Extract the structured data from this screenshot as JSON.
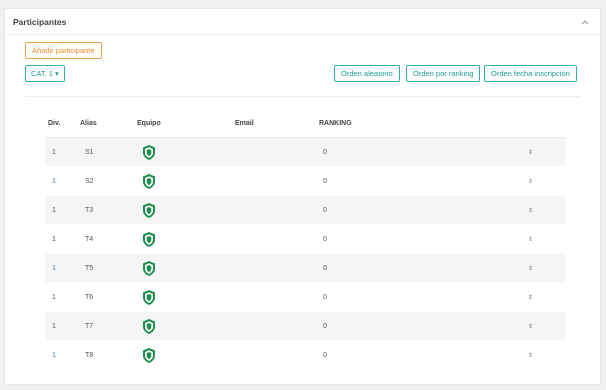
{
  "panel": {
    "title": "Participantes",
    "add_button_label": "Añadir participante",
    "category_button_label": "CAT. 1 ▾",
    "order_buttons": [
      "Orden aleatorio",
      "Orden por ranking",
      "Orden fecha inscripción"
    ]
  },
  "table": {
    "headers": {
      "div": "Div.",
      "alias": "Alias",
      "team": "Equipo",
      "email": "Email",
      "ranking": "RANKING"
    },
    "rows": [
      {
        "div": "1",
        "alias": "S1",
        "team_icon": "shield-icon",
        "email": "",
        "ranking": "0",
        "sort": "⇕"
      },
      {
        "div": "1",
        "alias": "S2",
        "team_icon": "shield-icon",
        "email": "",
        "ranking": "0",
        "sort": "⇕"
      },
      {
        "div": "1",
        "alias": "T3",
        "team_icon": "shield-icon",
        "email": "",
        "ranking": "0",
        "sort": "⇕"
      },
      {
        "div": "1",
        "alias": "T4",
        "team_icon": "shield-icon",
        "email": "",
        "ranking": "0",
        "sort": "⇕"
      },
      {
        "div": "1",
        "alias": "T5",
        "team_icon": "shield-icon",
        "email": "",
        "ranking": "0",
        "sort": "⇕"
      },
      {
        "div": "1",
        "alias": "T6",
        "team_icon": "shield-icon",
        "email": "",
        "ranking": "0",
        "sort": "⇕"
      },
      {
        "div": "1",
        "alias": "T7",
        "team_icon": "shield-icon",
        "email": "",
        "ranking": "0",
        "sort": "⇕"
      },
      {
        "div": "1",
        "alias": "T8",
        "team_icon": "shield-icon",
        "email": "",
        "ranking": "0",
        "sort": "⇕"
      }
    ]
  },
  "colors": {
    "accent_orange": "#ef8c2a",
    "accent_teal": "#1d9e8e",
    "shield_green": "#1e8f4e",
    "link_blue": "#2c7bbf"
  }
}
